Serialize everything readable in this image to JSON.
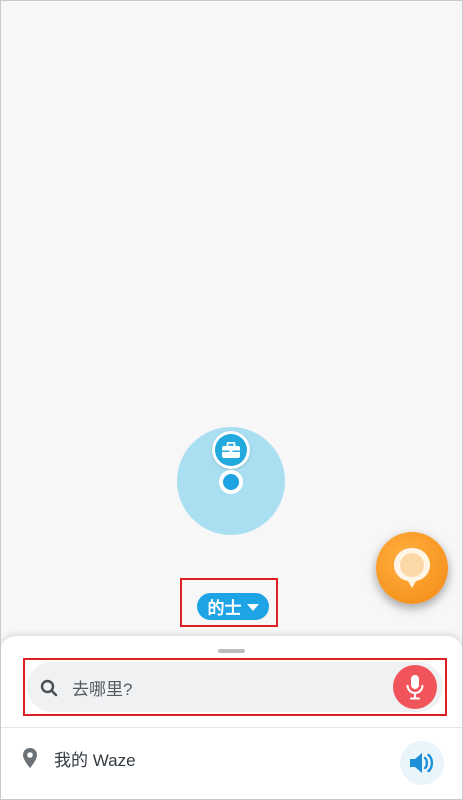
{
  "map": {
    "transport_mode": "的士",
    "pin_icon": "briefcase-icon",
    "report_icon": "report-bubble-icon"
  },
  "search": {
    "placeholder": "去哪里?",
    "search_icon": "search-icon",
    "mic_icon": "microphone-icon"
  },
  "menu": {
    "my_waze_label": "我的 Waze",
    "location_icon": "location-pin-icon",
    "sound_icon": "speaker-icon"
  },
  "colors": {
    "accent_blue": "#1ea3e4",
    "mic_red": "#f2545b",
    "report_orange": "#f48a16",
    "highlight_red": "#e02020"
  }
}
